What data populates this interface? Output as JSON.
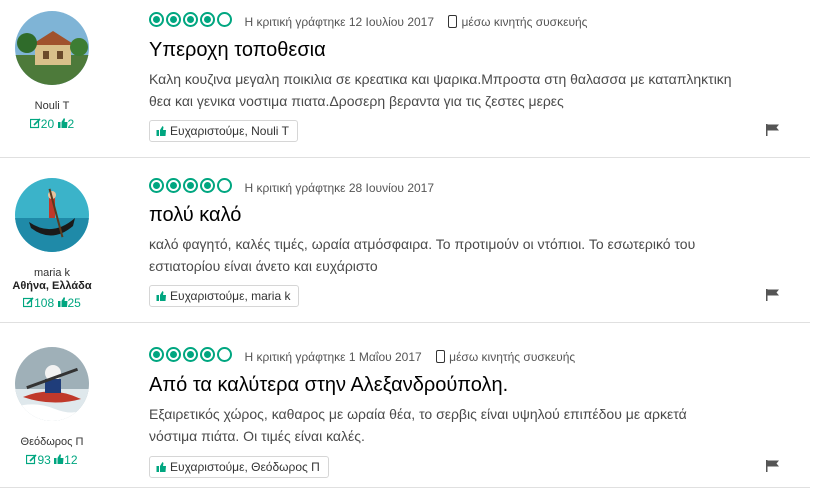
{
  "reviews": [
    {
      "rating": 4,
      "date": "Η κριτική γράφτηκε 12 Ιουλίου 2017",
      "mobile": "μέσω κινητής συσκευής",
      "title": "Υπεροχη τοποθεσια",
      "body_lines": [
        "Καλη κουζινα μεγαλη ποικιλια σε κρεατικα και ψαρικα.Μπροστα στη θαλασσα με καταπληκτικη",
        "θεα και γενικα νοστιμα πιατα.Δροσερη βεραντα για τις ζεστες μερες"
      ],
      "thanks": "Ευχαριστούμε, Nouli T",
      "member": {
        "name": "Nouli T",
        "location": "",
        "reviews": "20",
        "helpful": "2"
      }
    },
    {
      "rating": 4,
      "date": "Η κριτική γράφτηκε 28 Ιουνίου 2017",
      "mobile": "",
      "title": "πολύ καλό",
      "body_lines": [
        "καλό φαγητό, καλές τιμές, ωραία ατμόσφαιρα. Το προτιμούν οι ντόπιοι. Το εσωτερικό του",
        "εστιατορίου είναι άνετο και ευχάριστο"
      ],
      "thanks": "Ευχαριστούμε, maria k",
      "member": {
        "name": "maria k",
        "location": "Αθήνα, Ελλάδα",
        "reviews": "108",
        "helpful": "25"
      }
    },
    {
      "rating": 4,
      "date": "Η κριτική γράφτηκε 1 Μαΐου 2017",
      "mobile": "μέσω κινητής συσκευής",
      "title": "Από τα καλύτερα στην Αλεξανδρούπολη.",
      "body_lines": [
        "Εξαιρετικός χώρος, καθαρος με ωραία θέα, το σερβις είναι υψηλού επιπέδου με αρκετά",
        "νόστιμα πιάτα. Οι τιμές είναι καλές."
      ],
      "thanks": "Ευχαριστούμε, Θεόδωρος Π",
      "member": {
        "name": "Θεόδωρος Π",
        "location": "",
        "reviews": "93",
        "helpful": "12"
      }
    }
  ],
  "colors": {
    "accent": "#00a680",
    "title": "#000000",
    "body": "#4a4a4a"
  },
  "icons": [
    "review-count-icon",
    "helpful-thumb-icon",
    "mobile-phone-icon",
    "thumbs-up-icon",
    "flag-icon"
  ]
}
